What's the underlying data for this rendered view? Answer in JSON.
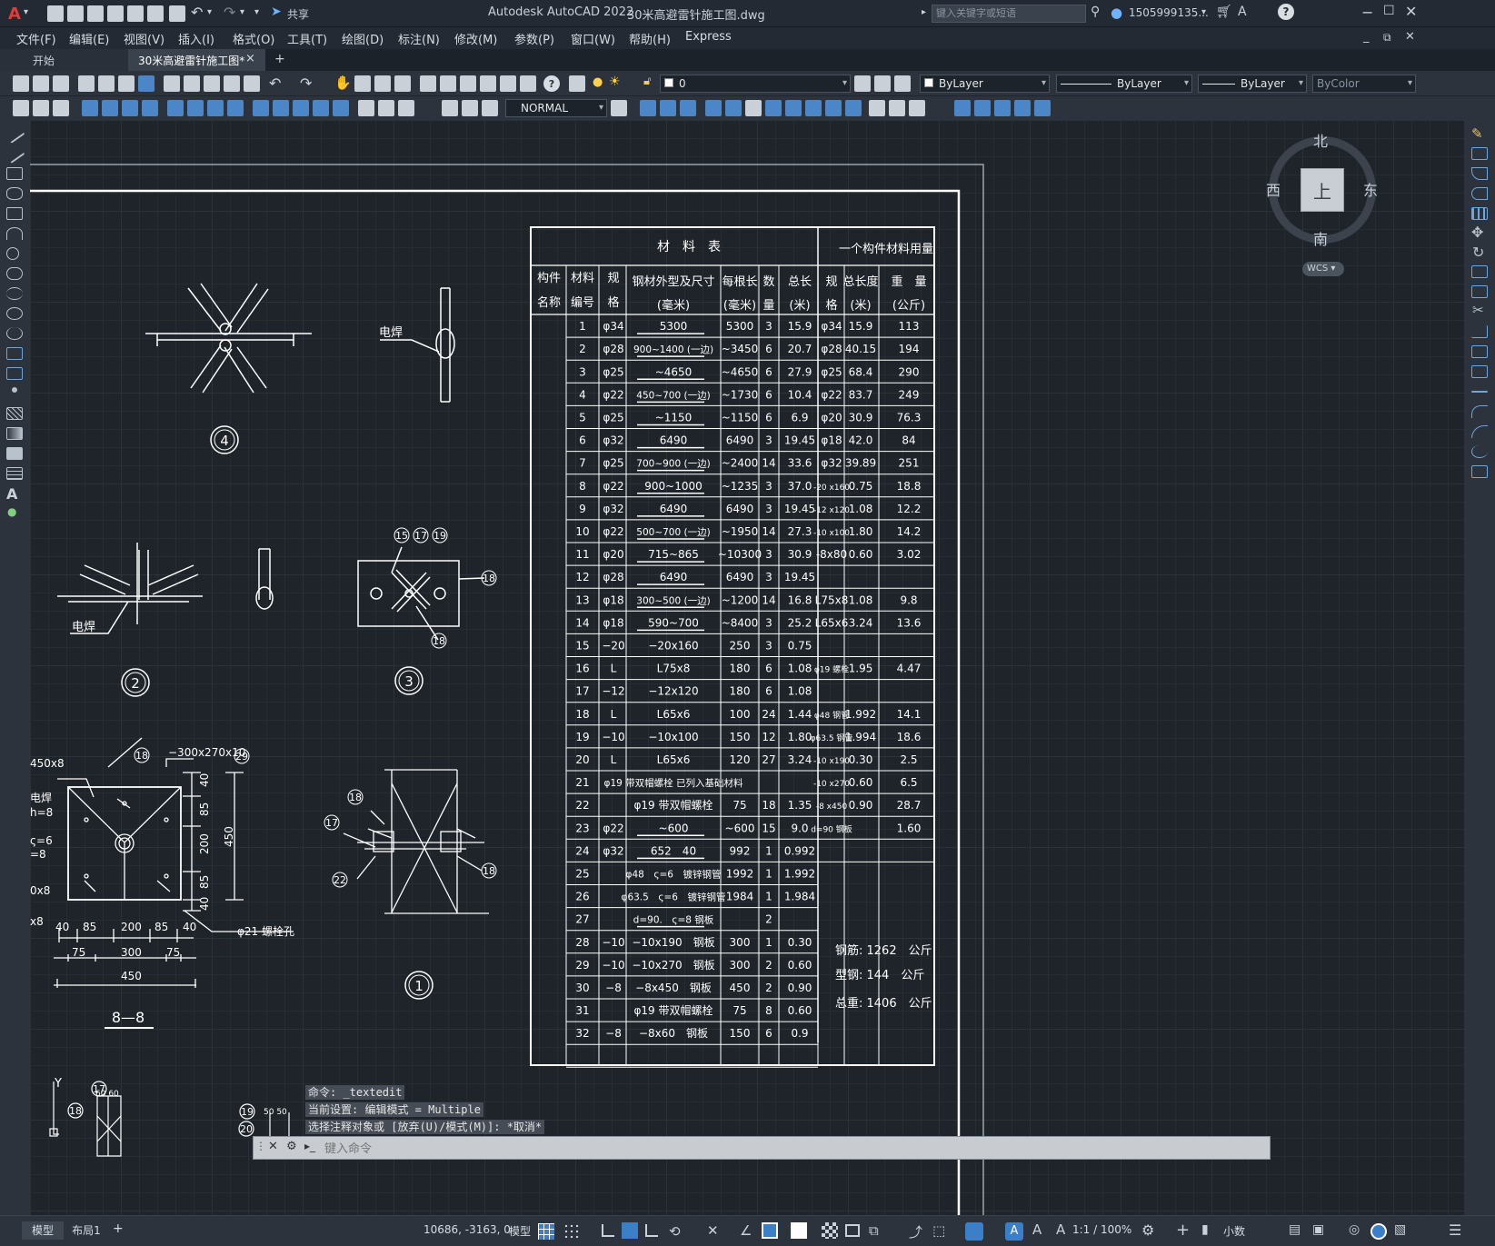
{
  "title": {
    "app": "Autodesk AutoCAD 2022",
    "file": "30米高避雷针施工图.dwg",
    "share": "共享",
    "search_placeholder": "键入关键字或短语",
    "user": "1505999135...",
    "logo": "A"
  },
  "menu": [
    "文件(F)",
    "编辑(E)",
    "视图(V)",
    "插入(I)",
    "格式(O)",
    "工具(T)",
    "绘图(D)",
    "标注(N)",
    "修改(M)",
    "参数(P)",
    "窗口(W)",
    "帮助(H)",
    "Express"
  ],
  "tabs": {
    "start": "开始",
    "doc": "30米高避雷针施工图*",
    "close": "×",
    "add": "+"
  },
  "toolbar": {
    "layer": "0",
    "color": "ByLayer",
    "linetype": "ByLayer",
    "lineweight": "ByLayer",
    "plotstyle": "ByColor",
    "dimstyle": "NORMAL"
  },
  "viewcube": {
    "north": "北",
    "south": "南",
    "east": "东",
    "west": "西",
    "top": "上",
    "wcs": "WCS"
  },
  "command": {
    "line1": "命令: _textedit",
    "line2": "当前设置: 编辑模式 = Multiple",
    "line3": "选择注释对象或 [放弃(U)/模式(M)]: *取消*",
    "placeholder": "键入命令"
  },
  "status": {
    "model_tab": "模型",
    "layout_tab": "布局1",
    "add": "+",
    "coords": "10686, -3163, 0",
    "model": "模型",
    "scale": "1:1 / 100%",
    "units": "小数"
  },
  "drawing": {
    "table_title": "材　料　表",
    "one_member": "一个构件材料用量",
    "headers": {
      "c1": [
        "构件",
        "名称"
      ],
      "c2": [
        "材料",
        "编号"
      ],
      "c3": [
        "规",
        "格"
      ],
      "c4": [
        "钢材外型及尺寸",
        "(毫米)"
      ],
      "c5": [
        "每根长",
        "(毫米)"
      ],
      "c6": [
        "数",
        "量"
      ],
      "c7": [
        "总长",
        "(米)"
      ],
      "c8": [
        "规",
        "格"
      ],
      "c9": [
        "总长度",
        "(米)"
      ],
      "c10": [
        "重　量",
        "(公斤)"
      ]
    },
    "rows": [
      {
        "n": "1",
        "s": "φ34",
        "d": "5300",
        "l": "5300",
        "q": "3",
        "t": "15.9",
        "s2": "φ34",
        "t2": "15.9",
        "w": "113"
      },
      {
        "n": "2",
        "s": "φ28",
        "d": "900~1400 (一边)",
        "l": "~3450",
        "q": "6",
        "t": "20.7",
        "s2": "φ28",
        "t2": "40.15",
        "w": "194"
      },
      {
        "n": "3",
        "s": "φ25",
        "d": "~4650",
        "l": "~4650",
        "q": "6",
        "t": "27.9",
        "s2": "φ25",
        "t2": "68.4",
        "w": "290"
      },
      {
        "n": "4",
        "s": "φ22",
        "d": "450~700 (一边)",
        "l": "~1730",
        "q": "6",
        "t": "10.4",
        "s2": "φ22",
        "t2": "83.7",
        "w": "249"
      },
      {
        "n": "5",
        "s": "φ25",
        "d": "~1150",
        "l": "~1150",
        "q": "6",
        "t": "6.9",
        "s2": "φ20",
        "t2": "30.9",
        "w": "76.3"
      },
      {
        "n": "6",
        "s": "φ32",
        "d": "6490",
        "l": "6490",
        "q": "3",
        "t": "19.45",
        "s2": "φ18",
        "t2": "42.0",
        "w": "84"
      },
      {
        "n": "7",
        "s": "φ25",
        "d": "700~900 (一边)",
        "l": "~2400",
        "q": "14",
        "t": "33.6",
        "s2": "φ32",
        "t2": "39.89",
        "w": "251"
      },
      {
        "n": "8",
        "s": "φ22",
        "d": "900~1000",
        "l": "~1235",
        "q": "3",
        "t": "37.0",
        "s2": "-20 x160",
        "t2": "0.75",
        "w": "18.8"
      },
      {
        "n": "9",
        "s": "φ32",
        "d": "6490",
        "l": "6490",
        "q": "3",
        "t": "19.45",
        "s2": "-12 x120",
        "t2": "1.08",
        "w": "12.2"
      },
      {
        "n": "10",
        "s": "φ22",
        "d": "500~700 (一边)",
        "l": "~1950",
        "q": "14",
        "t": "27.3",
        "s2": "-10 x100",
        "t2": "1.80",
        "w": "14.2"
      },
      {
        "n": "11",
        "s": "φ20",
        "d": "715~865",
        "l": "~10300",
        "q": "3",
        "t": "30.9",
        "s2": "-8x80",
        "t2": "0.60",
        "w": "3.02"
      },
      {
        "n": "12",
        "s": "φ28",
        "d": "6490",
        "l": "6490",
        "q": "3",
        "t": "19.45",
        "s2": "",
        "t2": "",
        "w": ""
      },
      {
        "n": "13",
        "s": "φ18",
        "d": "300~500 (一边)",
        "l": "~1200",
        "q": "14",
        "t": "16.8",
        "s2": "L75x8",
        "t2": "1.08",
        "w": "9.8"
      },
      {
        "n": "14",
        "s": "φ18",
        "d": "590~700",
        "l": "~8400",
        "q": "3",
        "t": "25.2",
        "s2": "L65x6",
        "t2": "3.24",
        "w": "13.6"
      },
      {
        "n": "15",
        "s": "−20",
        "d": "−20x160",
        "l": "250",
        "q": "3",
        "t": "0.75",
        "s2": "",
        "t2": "",
        "w": ""
      },
      {
        "n": "16",
        "s": "L",
        "d": "L75x8",
        "l": "180",
        "q": "6",
        "t": "1.08",
        "s2": "φ19 螺栓",
        "t2": "1.95",
        "w": "4.47"
      },
      {
        "n": "17",
        "s": "−12",
        "d": "−12x120",
        "l": "180",
        "q": "6",
        "t": "1.08",
        "s2": "",
        "t2": "",
        "w": ""
      },
      {
        "n": "18",
        "s": "L",
        "d": "L65x6",
        "l": "100",
        "q": "24",
        "t": "1.44",
        "s2": "φ48 钢管",
        "t2": "1.992",
        "w": "14.1"
      },
      {
        "n": "19",
        "s": "−10",
        "d": "−10x100",
        "l": "150",
        "q": "12",
        "t": "1.80",
        "s2": "φ63.5 钢管",
        "t2": "1.994",
        "w": "18.6"
      },
      {
        "n": "20",
        "s": "L",
        "d": "L65x6",
        "l": "120",
        "q": "27",
        "t": "3.24",
        "s2": "-10 x190",
        "t2": "0.30",
        "w": "2.5"
      },
      {
        "n": "21",
        "s": "",
        "d": "φ19 带双帽螺栓 已列入基础材料",
        "l": "",
        "q": "",
        "t": "",
        "s2": "-10 x270",
        "t2": "0.60",
        "w": "6.5"
      },
      {
        "n": "22",
        "s": "",
        "d": "φ19 带双帽螺栓",
        "l": "75",
        "q": "18",
        "t": "1.35",
        "s2": "-8 x450",
        "t2": "0.90",
        "w": "28.7"
      },
      {
        "n": "23",
        "s": "φ22",
        "d": "~600",
        "l": "~600",
        "q": "15",
        "t": "9.0",
        "s2": "d=90 钢板",
        "t2": "",
        "w": "1.60"
      },
      {
        "n": "24",
        "s": "φ32",
        "d": "652　40",
        "l": "992",
        "q": "1",
        "t": "0.992",
        "s2": "",
        "t2": "",
        "w": ""
      },
      {
        "n": "25",
        "s": "",
        "d": "φ48　ς=6　镀锌钢管",
        "l": "1992",
        "q": "1",
        "t": "1.992",
        "s2": "",
        "t2": "",
        "w": ""
      },
      {
        "n": "26",
        "s": "",
        "d": "φ63.5　ς=6　镀锌钢管",
        "l": "1984",
        "q": "1",
        "t": "1.984",
        "s2": "",
        "t2": "",
        "w": ""
      },
      {
        "n": "27",
        "s": "",
        "d": "d=90.　ς=8 钢板",
        "l": "",
        "q": "2",
        "t": "",
        "s2": "",
        "t2": "",
        "w": ""
      },
      {
        "n": "28",
        "s": "−10",
        "d": "−10x190　钢板",
        "l": "300",
        "q": "1",
        "t": "0.30",
        "s2": "",
        "t2": "",
        "w": ""
      },
      {
        "n": "29",
        "s": "−10",
        "d": "−10x270　钢板",
        "l": "300",
        "q": "2",
        "t": "0.60",
        "s2": "",
        "t2": "",
        "w": ""
      },
      {
        "n": "30",
        "s": "−8",
        "d": "−8x450　钢板",
        "l": "450",
        "q": "2",
        "t": "0.90",
        "s2": "",
        "t2": "",
        "w": ""
      },
      {
        "n": "31",
        "s": "",
        "d": "φ19 带双帽螺栓",
        "l": "75",
        "q": "8",
        "t": "0.60",
        "s2": "",
        "t2": "",
        "w": ""
      },
      {
        "n": "32",
        "s": "−8",
        "d": "−8x60　钢板",
        "l": "150",
        "q": "6",
        "t": "0.9",
        "s2": "",
        "t2": "",
        "w": ""
      }
    ],
    "totals": [
      "钢筋: 1262　公斤",
      "型钢: 144　公斤",
      "总重: 1406　公斤"
    ],
    "labels": {
      "weld": "电焊",
      "weld2": "电焊",
      "section": "8—8",
      "bolt_hole": "φ21 螺栓孔",
      "plate": "−300x270x10",
      "d450": "450x8",
      "c4": "4",
      "c2": "2",
      "c3": "3",
      "c1": "1",
      "d40": "40",
      "d85": "85",
      "d200": "200",
      "d85b": "85",
      "d40b": "40",
      "d75": "75",
      "d300": "300",
      "d75b": "75",
      "d450b": "450",
      "v40": "40",
      "v85": "85",
      "v200": "200",
      "v85b": "85",
      "v40b": "40",
      "v450": "450",
      "weldL": "电焊",
      "hn8": "h=8",
      "s6": "ς=6",
      "m8": "=8",
      "x8a": "0x8",
      "x8b": "x8",
      "Y": "Y",
      "n15": "15",
      "n17": "17",
      "n19": "19",
      "n18": "18",
      "n18b": "18",
      "n29": "29",
      "n18c": "18",
      "n17b": "17",
      "n22": "22",
      "n18d": "18",
      "n18e": "18",
      "n17c": "17",
      "n18f": "18",
      "n19b": "19",
      "n20": "20",
      "n60": "60 60",
      "n5050": "50 50"
    }
  }
}
